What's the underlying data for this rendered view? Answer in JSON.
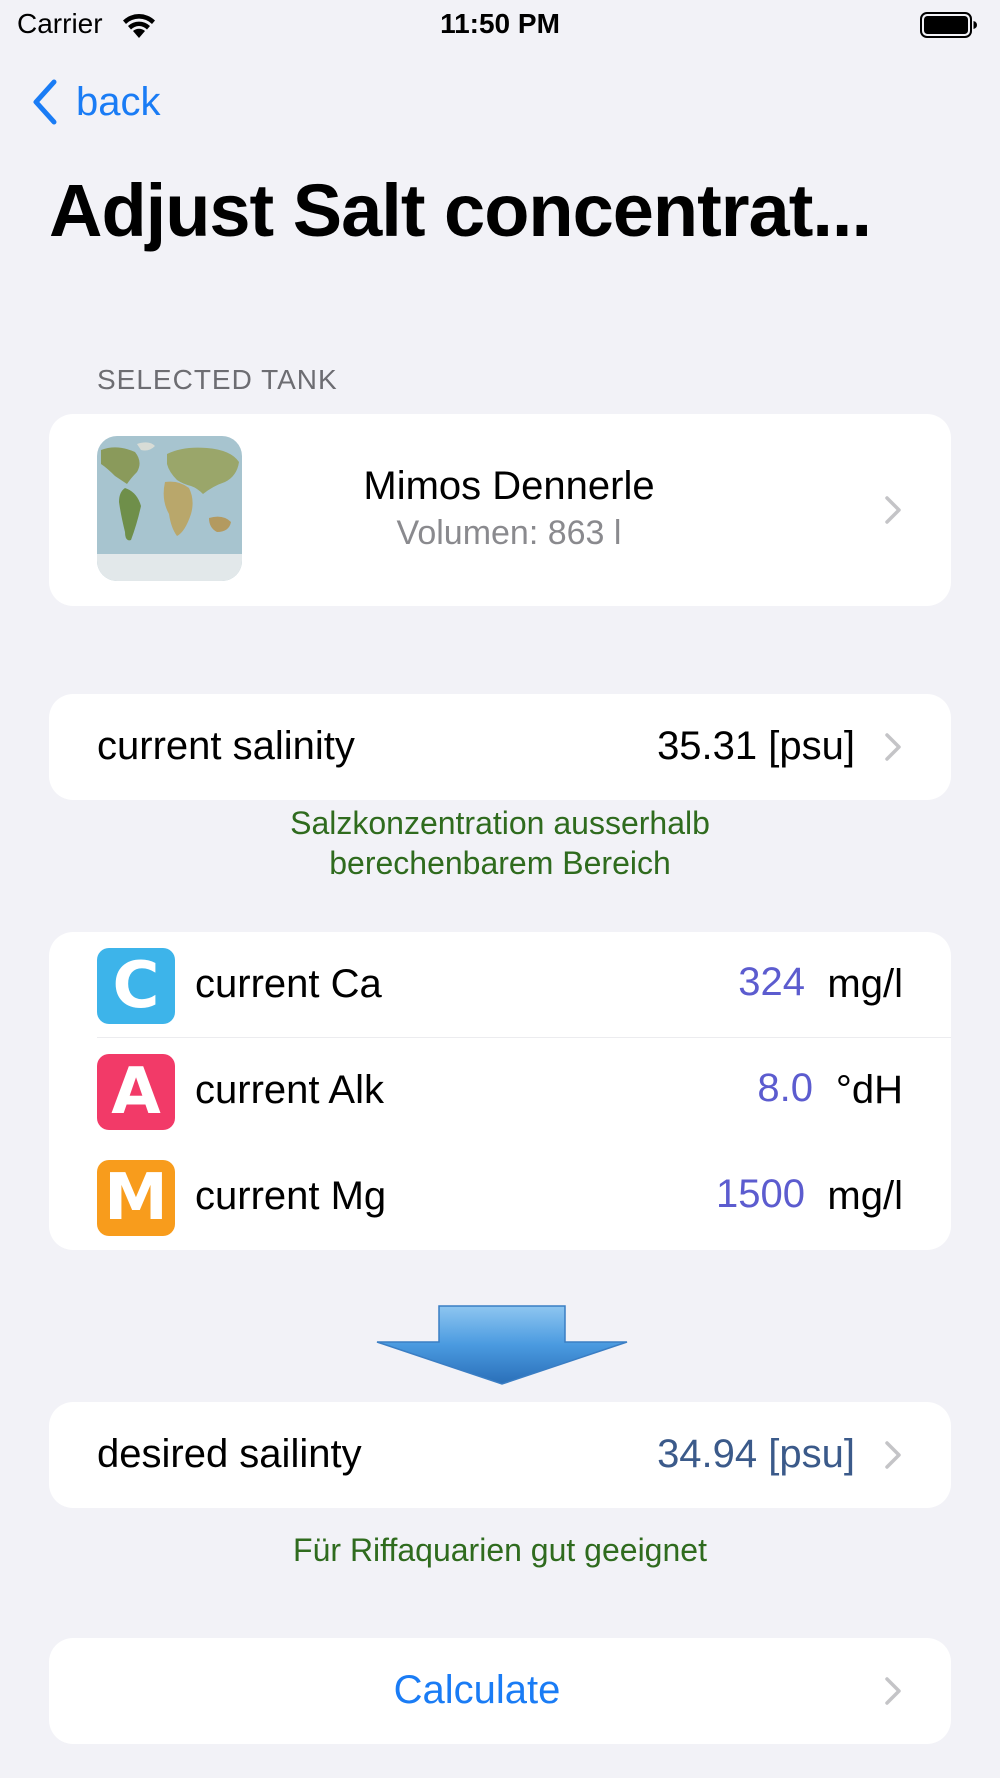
{
  "status_bar": {
    "carrier": "Carrier",
    "time": "11:50 PM"
  },
  "nav": {
    "back_label": "back"
  },
  "page_title": "Adjust Salt concentrat...",
  "section_header": "SELECTED TANK",
  "tank": {
    "name": "Mimos Dennerle",
    "volume": "Volumen: 863 l"
  },
  "current_salinity": {
    "label": "current salinity",
    "value": "35.31 [psu]",
    "note_line1": "Salzkonzentration ausserhalb",
    "note_line2": "berechenbarem Bereich"
  },
  "ions": [
    {
      "badge": "C",
      "label": "current Ca",
      "value": "324",
      "unit": "mg/l"
    },
    {
      "badge": "A",
      "label": "current Alk",
      "value": "8.0",
      "unit": "°dH"
    },
    {
      "badge": "M",
      "label": "current Mg",
      "value": "1500",
      "unit": "mg/l"
    }
  ],
  "desired_salinity": {
    "label": "desired sailinty",
    "value": "34.94 [psu]",
    "note": "Für Riffaquarien gut geeignet"
  },
  "calculate": {
    "label": "Calculate"
  },
  "colors": {
    "background": "#f2f2f7",
    "accent": "#1a7cf5",
    "note_green": "#2f6b1e",
    "ion_value": "#5c5ccf",
    "desired_value": "#3b5a8a",
    "badge_ca": "#3db4ea",
    "badge_alk": "#f23a68",
    "badge_mg": "#f89c1c"
  },
  "icons": {
    "back": "chevron-left-icon",
    "disclosure": "chevron-right-icon",
    "arrow": "down-arrow-icon",
    "tank_image": "world-map-thumbnail"
  }
}
